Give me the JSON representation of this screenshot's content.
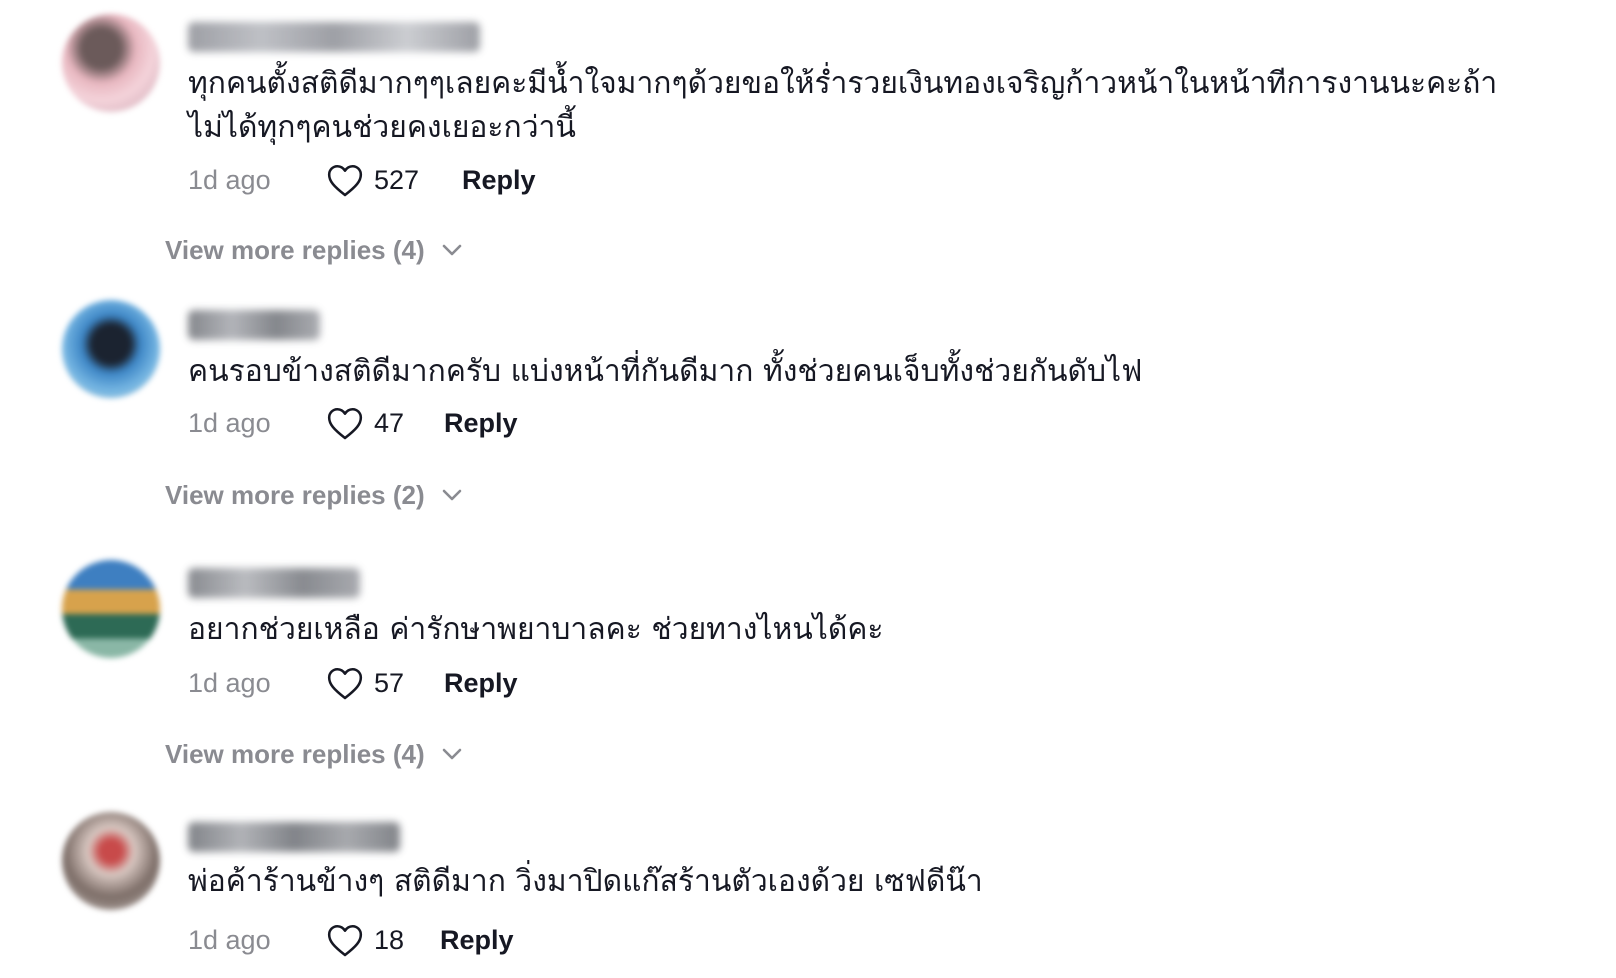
{
  "colors": {
    "text_primary": "#161823",
    "text_secondary": "#8a8b91"
  },
  "icons": {
    "like": "heart-outline-icon",
    "expand": "chevron-down-icon"
  },
  "comments": [
    {
      "text": "ทุกคนตั้งสติดีมากๆๆเลยคะมีน้ำใจมากๆด้วยขอให้ร่ำรวยเงินทองเจริญก้าวหน้าในหน้าทีการงานนะคะถ้าไม่ได้ทุกๆคนช่วยคงเยอะกว่านี้",
      "time": "1d ago",
      "likes": "527",
      "reply_label": "Reply",
      "more_replies": "View more replies (4)"
    },
    {
      "text": "คนรอบข้างสติดีมากครับ แบ่งหน้าที่กันดีมาก ทั้งช่วยคนเจ็บทั้งช่วยกันดับไฟ",
      "time": "1d ago",
      "likes": "47",
      "reply_label": "Reply",
      "more_replies": "View more replies (2)"
    },
    {
      "text": "อยากช่วยเหลือ ค่ารักษาพยาบาลคะ ช่วยทางไหนได้คะ",
      "time": "1d ago",
      "likes": "57",
      "reply_label": "Reply",
      "more_replies": "View more replies (4)"
    },
    {
      "text": "พ่อค้าร้านข้างๆ สติดีมาก วิ่งมาปิดแก๊สร้านตัวเองด้วย เซฟดีน๊า",
      "time": "1d ago",
      "likes": "18",
      "reply_label": "Reply"
    }
  ]
}
